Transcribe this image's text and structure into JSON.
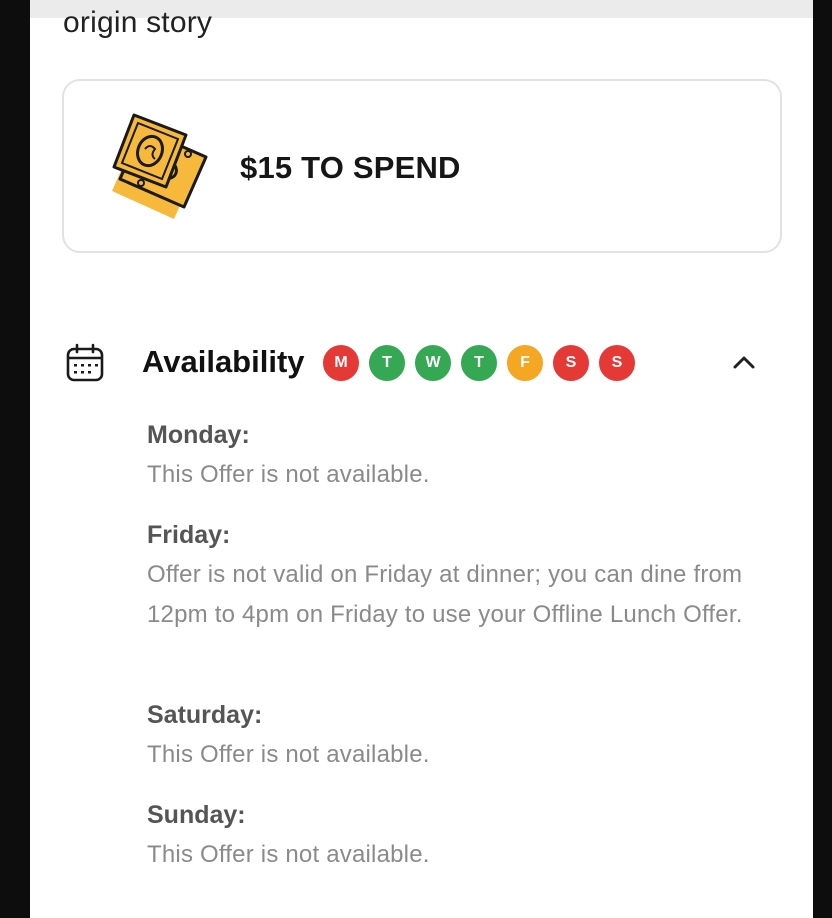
{
  "header": {
    "subtitle": "origin story"
  },
  "spend_card": {
    "icon": "money-bills-icon",
    "label": "$15 TO SPEND",
    "accent_color": "#f6b93b"
  },
  "availability": {
    "icon": "calendar-icon",
    "title": "Availability",
    "expanded": true,
    "toggle_icon": "chevron-up-icon",
    "days": [
      {
        "letter": "M",
        "status": "unavailable",
        "color": "#e53935"
      },
      {
        "letter": "T",
        "status": "available",
        "color": "#34a853"
      },
      {
        "letter": "W",
        "status": "available",
        "color": "#34a853"
      },
      {
        "letter": "T",
        "status": "available",
        "color": "#34a853"
      },
      {
        "letter": "F",
        "status": "partial",
        "color": "#f5a623"
      },
      {
        "letter": "S",
        "status": "unavailable",
        "color": "#e53935"
      },
      {
        "letter": "S",
        "status": "unavailable",
        "color": "#e53935"
      }
    ],
    "details": [
      {
        "day": "Monday:",
        "text": "This Offer is not available."
      },
      {
        "day": "Friday:",
        "text": "Offer is not valid on Friday at dinner; you can dine from 12pm to 4pm on Friday to use your Offline Lunch Offer."
      },
      {
        "day": "Saturday:",
        "text": "This Offer is not available."
      },
      {
        "day": "Sunday:",
        "text": "This Offer is not available."
      }
    ]
  }
}
